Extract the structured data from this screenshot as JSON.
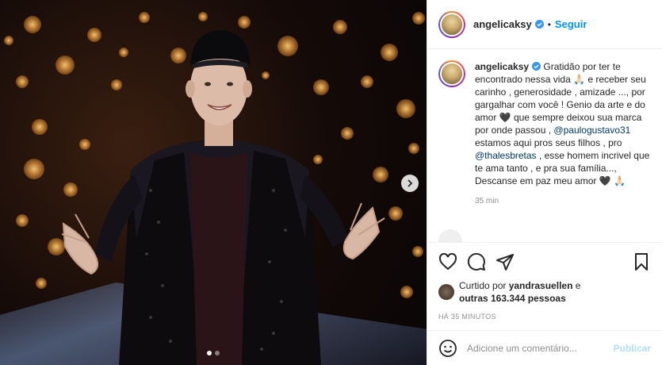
{
  "header": {
    "username": "angelicaksy",
    "separator": "•",
    "follow_label": "Seguir"
  },
  "caption": {
    "username": "angelicaksy",
    "text_1": " Gratidão por ter te encontrado nessa vida 🙏🏻 e receber seu carinho , generosidade , amizade ..., por gargalhar com você ! Genio da arte e do amor 🖤 que sempre deixou sua marca por onde passou ,",
    "mention_1": "@paulogustavo31",
    "text_2": " estamos aqui pros seus filhos , pro ",
    "mention_2": "@thalesbretas",
    "text_3": " , esse homem incrivel que te ama tanto , e pra sua família..., Descanse em paz meu amor 🖤 🙏🏻",
    "time": "35 min"
  },
  "likes": {
    "prefix": "Curtido por ",
    "user": "yandrasuellen",
    "middle": " e ",
    "others": "outras 163.344 pessoas"
  },
  "posted_ago": "HÁ 35 MINUTOS",
  "comment_box": {
    "placeholder": "Adicione um comentário...",
    "publish_label": "Publicar"
  },
  "icons": {
    "verified": "verified-badge-icon",
    "like": "heart-icon",
    "comment": "comment-icon",
    "share": "paper-plane-icon",
    "save": "bookmark-icon",
    "emoji": "smiley-icon",
    "next": "chevron-right-icon"
  },
  "carousel": {
    "current": 1,
    "total": 2
  },
  "colors": {
    "accent": "#0095f6",
    "publish_disabled": "#b2dffc",
    "muted": "#8e8e8e"
  }
}
